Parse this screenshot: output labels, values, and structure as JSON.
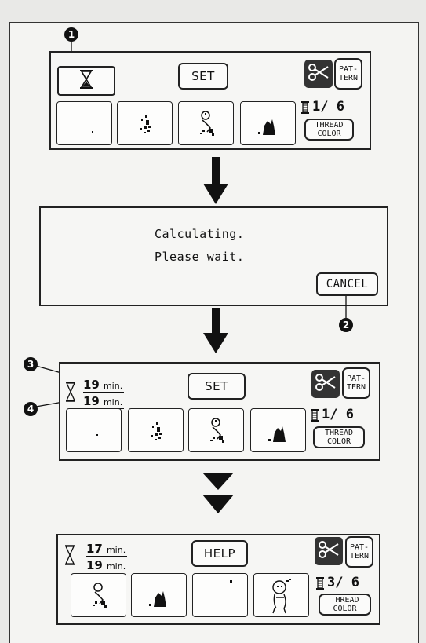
{
  "callouts": [
    "1",
    "2",
    "3",
    "4"
  ],
  "screen1": {
    "set_label": "SET",
    "pattern_label_1": "PAT-",
    "pattern_label_2": "TERN",
    "counter": "1/ 6",
    "thread_label_1": "THREAD",
    "thread_label_2": "COLOR"
  },
  "screen2": {
    "message_line1": "Calculating.",
    "message_line2": "Please wait.",
    "cancel_label": "CANCEL"
  },
  "screen3": {
    "time_total": "19",
    "time_remaining": "19",
    "time_unit": "min.",
    "set_label": "SET",
    "pattern_label_1": "PAT-",
    "pattern_label_2": "TERN",
    "counter": "1/ 6",
    "thread_label_1": "THREAD",
    "thread_label_2": "COLOR"
  },
  "screen4": {
    "time_total": "17",
    "time_remaining": "19",
    "time_unit": "min.",
    "help_label": "HELP",
    "pattern_label_1": "PAT-",
    "pattern_label_2": "TERN",
    "counter": "3/ 6",
    "thread_label_1": "THREAD",
    "thread_label_2": "COLOR"
  },
  "icons": {
    "hourglass": "hourglass-icon",
    "scissors": "scissors-icon",
    "spool": "thread-spool-icon",
    "arrow": "arrow-down-icon"
  }
}
